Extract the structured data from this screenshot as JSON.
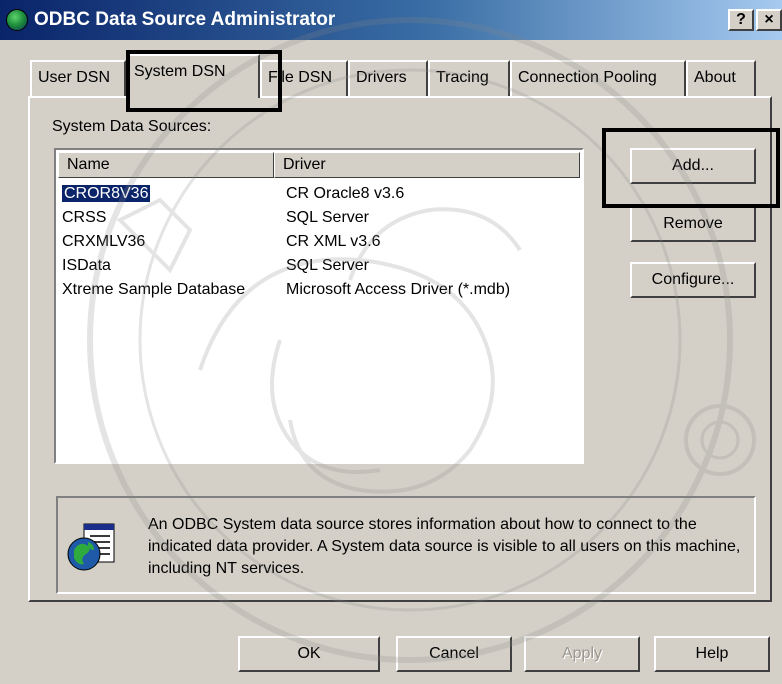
{
  "window": {
    "title": "ODBC Data Source Administrator",
    "help_glyph": "?",
    "close_glyph": "×"
  },
  "tabs": [
    {
      "label": "User DSN",
      "active": false
    },
    {
      "label": "System DSN",
      "active": true
    },
    {
      "label": "File DSN",
      "active": false
    },
    {
      "label": "Drivers",
      "active": false
    },
    {
      "label": "Tracing",
      "active": false
    },
    {
      "label": "Connection Pooling",
      "active": false
    },
    {
      "label": "About",
      "active": false
    }
  ],
  "system_dsn": {
    "sources_label": "System Data Sources:",
    "columns": [
      "Name",
      "Driver"
    ],
    "rows": [
      {
        "name": "CROR8V36",
        "driver": "CR Oracle8 v3.6",
        "selected": true
      },
      {
        "name": "CRSS",
        "driver": "SQL Server",
        "selected": false
      },
      {
        "name": "CRXMLV36",
        "driver": "CR XML v3.6",
        "selected": false
      },
      {
        "name": "ISData",
        "driver": "SQL Server",
        "selected": false
      },
      {
        "name": "Xtreme Sample Database",
        "driver": "Microsoft Access Driver (*.mdb)",
        "selected": false
      }
    ],
    "buttons": {
      "add": "Add...",
      "remove": "Remove",
      "configure": "Configure..."
    },
    "info_text": "An ODBC System data source stores information about how to connect to the indicated data provider.   A System data source is visible to all users on this machine, including NT services."
  },
  "footer": {
    "ok": "OK",
    "cancel": "Cancel",
    "apply": "Apply",
    "help": "Help"
  },
  "colors": {
    "face": "#d4d0c8",
    "title_start": "#0a246a",
    "title_end": "#a6caf0",
    "selection": "#0a246a"
  }
}
